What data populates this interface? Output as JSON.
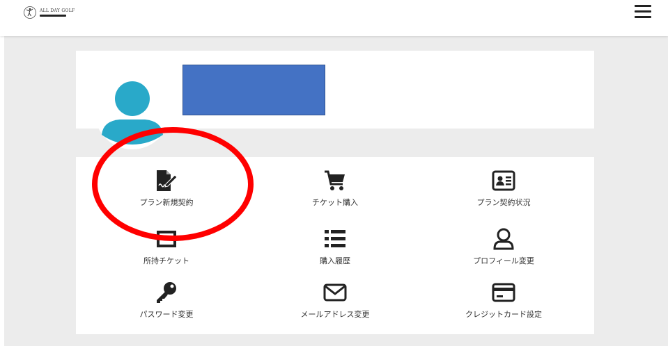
{
  "header": {
    "logo_text": "ALL DAY GOLF",
    "menu_icon": "hamburger-icon"
  },
  "profile": {
    "avatar_icon": "user-avatar-icon",
    "name_redaction_color": "#4472c4"
  },
  "menu": {
    "items": [
      {
        "label": "プラン新規契約",
        "icon": "contract-sign-icon"
      },
      {
        "label": "チケット購入",
        "icon": "cart-icon"
      },
      {
        "label": "プラン契約状況",
        "icon": "id-card-icon"
      },
      {
        "label": "所持チケット",
        "icon": "ticket-icon"
      },
      {
        "label": "購入履歴",
        "icon": "list-icon"
      },
      {
        "label": "プロフィール変更",
        "icon": "user-outline-icon"
      },
      {
        "label": "パスワード変更",
        "icon": "key-icon"
      },
      {
        "label": "メールアドレス変更",
        "icon": "envelope-icon"
      },
      {
        "label": "クレジットカード設定",
        "icon": "credit-card-icon"
      }
    ]
  },
  "annotation": {
    "shape": "ellipse",
    "color": "#ff0000"
  }
}
